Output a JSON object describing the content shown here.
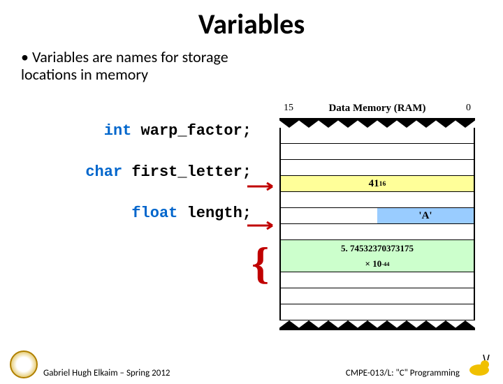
{
  "title": "Variables",
  "bullet": "Variables are names for storage locations in memory",
  "code": {
    "line1_kw": "int",
    "line1_rest": " warp_factor;",
    "line2_kw": "char",
    "line2_rest": " first_letter;",
    "line3_kw": "float",
    "line3_rest": " length;"
  },
  "memory": {
    "label": "Data Memory (RAM)",
    "bit_high": "15",
    "bit_low": "0",
    "val_int": "41",
    "val_int_sub": "16",
    "val_char": "'A'",
    "val_float_line1": "5. 74532370373175",
    "val_float_mult": "× 10",
    "val_float_exp": "-44"
  },
  "footer": {
    "left": "Gabriel Hugh Elkaim – Spring 2012",
    "right": "CMPE-013/L: \"C\" Programming"
  }
}
